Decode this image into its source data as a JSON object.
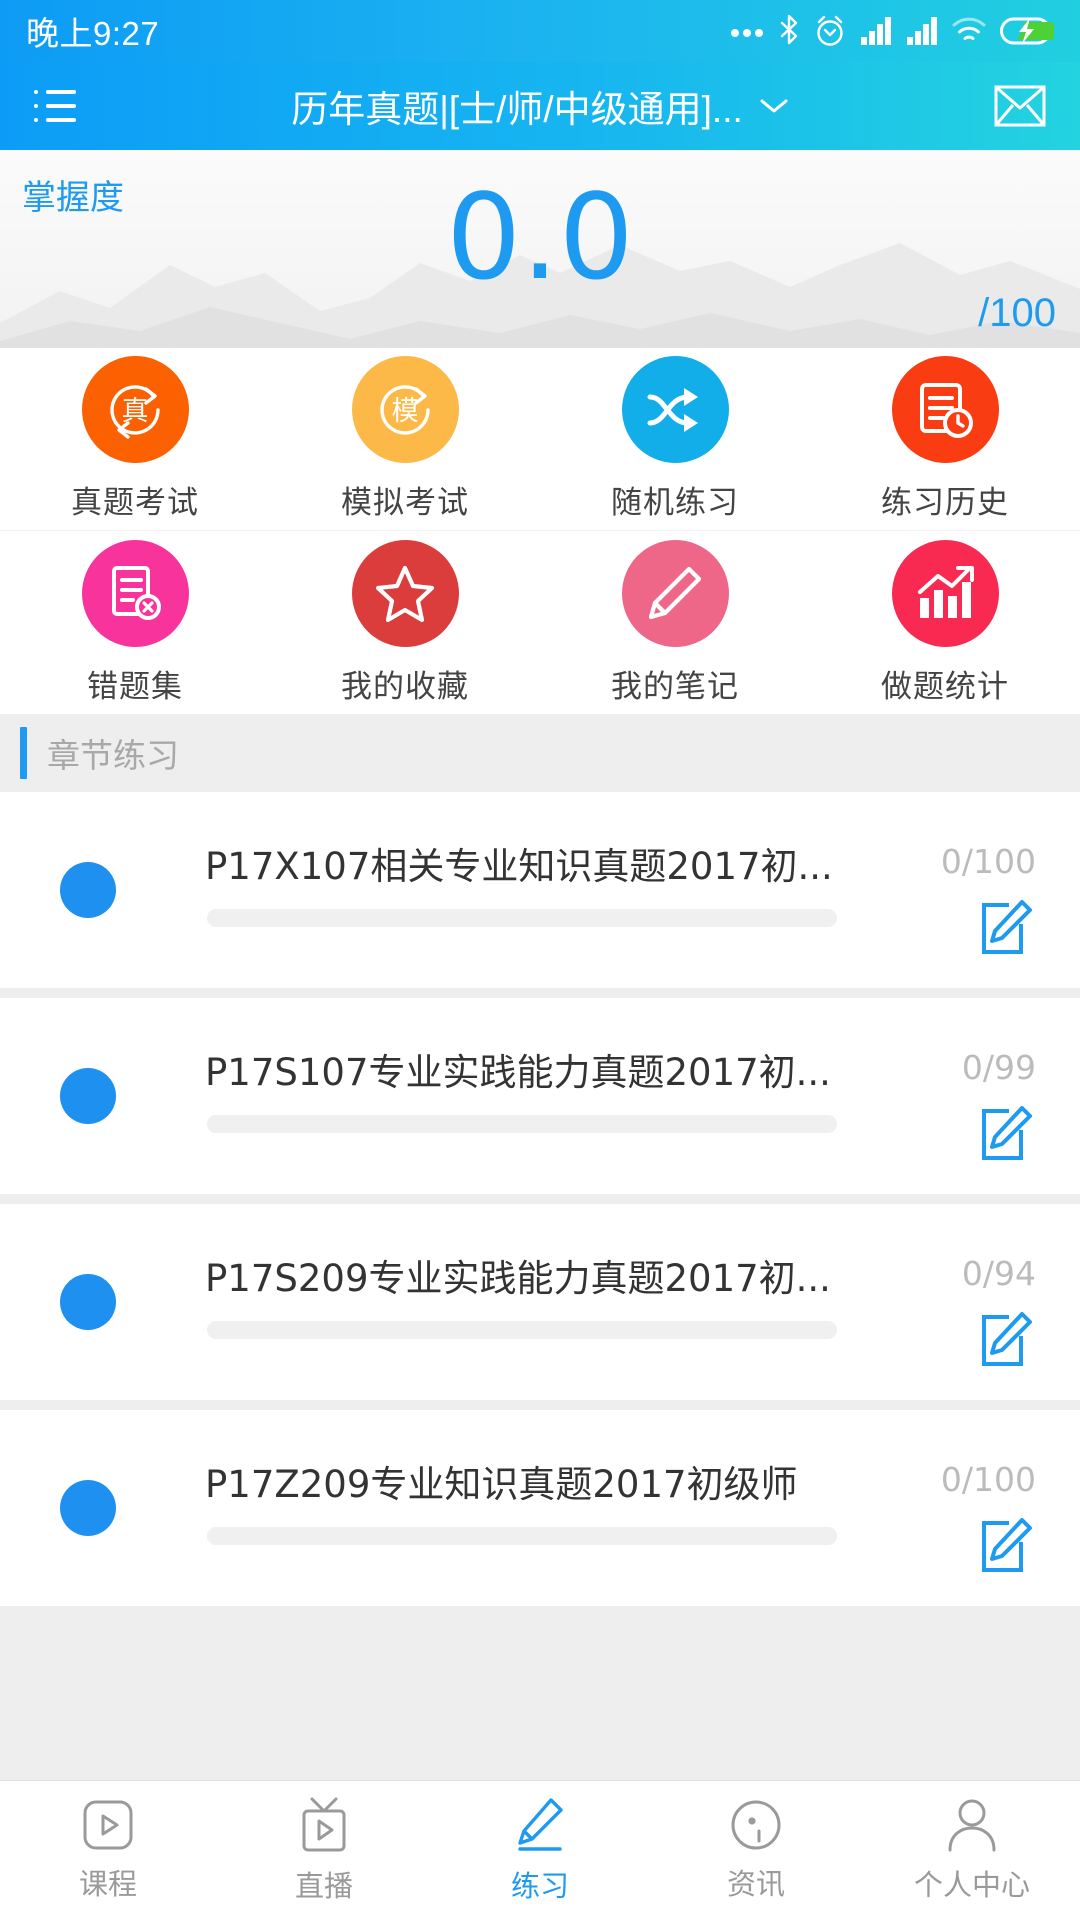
{
  "statusbar": {
    "time": "晚上9:27",
    "icons": [
      "more-dots-icon",
      "bluetooth-icon",
      "alarm-clock-icon",
      "signal-bars-icon",
      "signal-bars-2-icon",
      "wifi-icon",
      "battery-charging-icon"
    ]
  },
  "titlebar": {
    "menu_icon": "list-menu-icon",
    "title": "历年真题|[士/师/中级通用]...",
    "chevron_icon": "chevron-down-icon",
    "mail_icon": "envelope-icon"
  },
  "hero": {
    "label": "掌握度",
    "score": "0.0",
    "max": "/100",
    "accent": "#1e9bf0"
  },
  "grid": {
    "rows": [
      [
        {
          "label": "真题考试",
          "icon": "zhen-exam-icon",
          "color": "#FB6100"
        },
        {
          "label": "模拟考试",
          "icon": "mo-exam-icon",
          "color": "#FCB947"
        },
        {
          "label": "随机练习",
          "icon": "shuffle-icon",
          "color": "#12AEEA"
        },
        {
          "label": "练习历史",
          "icon": "history-doc-icon",
          "color": "#FA3C12"
        }
      ],
      [
        {
          "label": "错题集",
          "icon": "wrong-answers-icon",
          "color": "#F9339C"
        },
        {
          "label": "我的收藏",
          "icon": "star-icon",
          "color": "#DB3C3C"
        },
        {
          "label": "我的笔记",
          "icon": "pencil-icon",
          "color": "#EE6688"
        },
        {
          "label": "做题统计",
          "icon": "bar-chart-icon",
          "color": "#F82A52"
        }
      ]
    ]
  },
  "section": {
    "title": "章节练习"
  },
  "list": {
    "items": [
      {
        "title": "P17X107相关专业知识真题2017初...",
        "count": "0/100",
        "progress": 0,
        "edit_icon": "edit-note-icon",
        "dot": "status-dot"
      },
      {
        "title": "P17S107专业实践能力真题2017初...",
        "count": "0/99",
        "progress": 0,
        "edit_icon": "edit-note-icon",
        "dot": "status-dot"
      },
      {
        "title": "P17S209专业实践能力真题2017初...",
        "count": "0/94",
        "progress": 0,
        "edit_icon": "edit-note-icon",
        "dot": "status-dot"
      },
      {
        "title": "P17Z209专业知识真题2017初级师",
        "count": "0/100",
        "progress": 0,
        "edit_icon": "edit-note-icon",
        "dot": "status-dot"
      }
    ]
  },
  "tabbar": {
    "items": [
      {
        "label": "课程",
        "icon": "video-play-icon",
        "active": false
      },
      {
        "label": "直播",
        "icon": "tv-live-icon",
        "active": false
      },
      {
        "label": "练习",
        "icon": "pencil-icon",
        "active": true
      },
      {
        "label": "资讯",
        "icon": "news-icon",
        "active": false
      },
      {
        "label": "个人中心",
        "icon": "person-icon",
        "active": false
      }
    ],
    "active_color": "#1e9bf0",
    "inactive_color": "#9a9a9a"
  }
}
